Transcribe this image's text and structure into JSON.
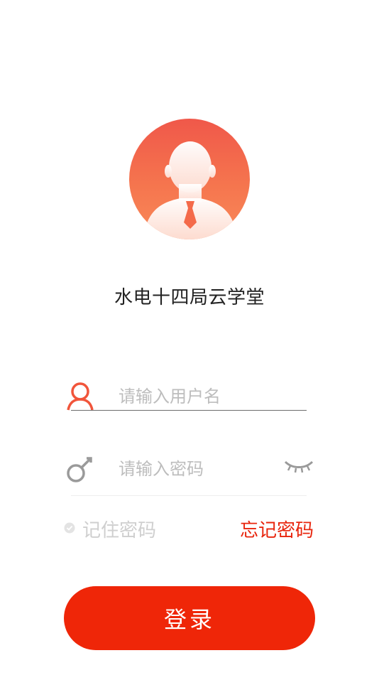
{
  "app": {
    "title": "水电十四局云学堂"
  },
  "colors": {
    "accent": "#ef2608",
    "link": "#e8250d",
    "avatar": "#f0584a"
  },
  "form": {
    "username": {
      "icon": "person-icon",
      "placeholder": "请输入用户名",
      "value": ""
    },
    "password": {
      "icon": "key-icon",
      "placeholder": "请输入密码",
      "value": "",
      "toggle_icon": "eye-closed-icon"
    },
    "remember_label": "记住密码",
    "remember_checked": false,
    "forgot_label": "忘记密码",
    "login_label": "登录"
  }
}
